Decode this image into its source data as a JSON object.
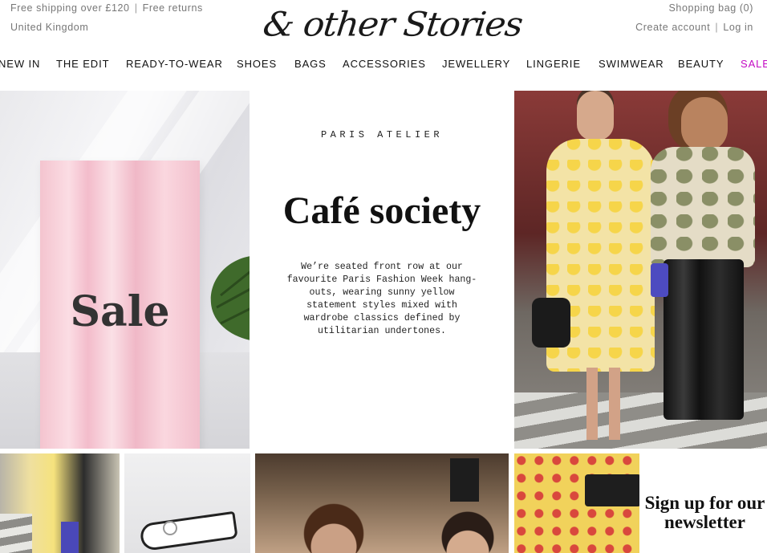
{
  "utility": {
    "shipping": "Free shipping over £120",
    "returns": "Free returns",
    "region": "United Kingdom",
    "bag": "Shopping bag (0)",
    "create_account": "Create account",
    "login": "Log in",
    "separator": "|"
  },
  "brand": {
    "logo": "& other Stories"
  },
  "nav": {
    "items": [
      {
        "label": "NEW IN"
      },
      {
        "label": "THE EDIT"
      },
      {
        "label": "READY-TO-WEAR"
      },
      {
        "label": "SHOES"
      },
      {
        "label": "BAGS"
      },
      {
        "label": "ACCESSORIES"
      },
      {
        "label": "JEWELLERY"
      },
      {
        "label": "LINGERIE"
      },
      {
        "label": "SWIMWEAR"
      },
      {
        "label": "BEAUTY"
      },
      {
        "label": "SALE"
      }
    ],
    "sale_color": "#c40cc4"
  },
  "hero": {
    "sale_label": "Sale",
    "eyebrow": "PARIS ATELIER",
    "headline": "Café society",
    "blurb": "We’re seated front row at our favourite Paris Fashion Week hang-outs, wearing sunny yellow statement styles mixed with wardrobe classics defined by utilitarian undertones."
  },
  "newsletter": {
    "title": "Sign up for our newsletter"
  }
}
